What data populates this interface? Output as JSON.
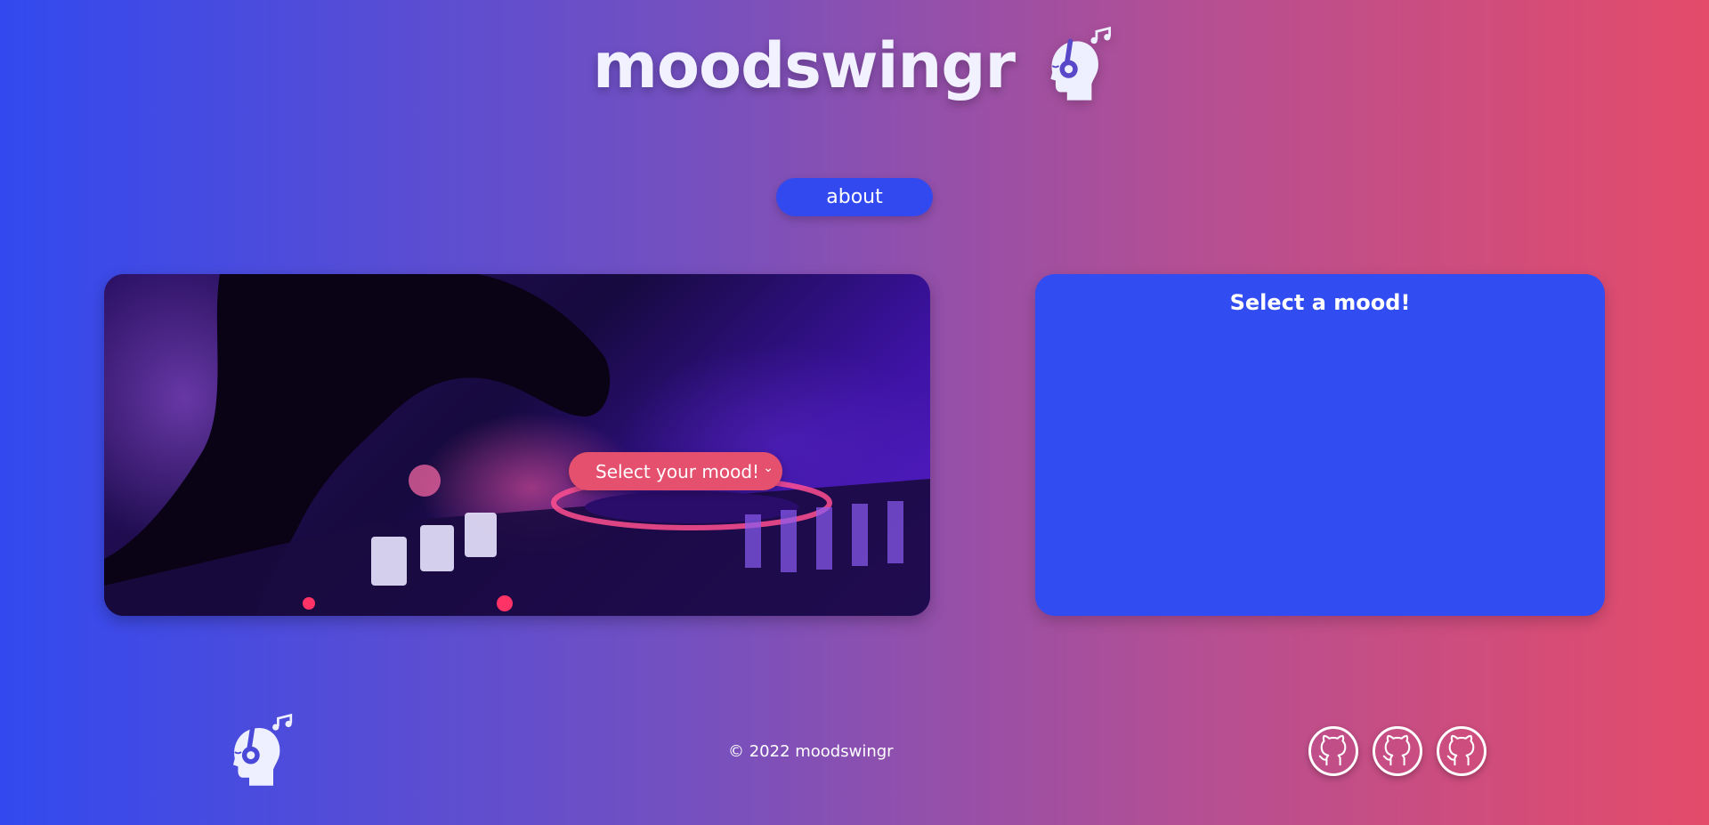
{
  "header": {
    "brand": "moodswingr",
    "logo_icon": "head-headphones-music-icon"
  },
  "nav": {
    "about_label": "about"
  },
  "hero": {
    "mood_select_value": "Select your mood!",
    "image_description_icon": "dj-mixer-image"
  },
  "mood_panel": {
    "title": "Select a mood!"
  },
  "footer": {
    "copyright": "© 2022 moodswingr",
    "logo_icon": "head-headphones-music-icon",
    "social_icons": [
      "github-icon",
      "github-icon",
      "github-icon"
    ]
  },
  "colors": {
    "primary_blue": "#3249ef",
    "accent_pink": "#e4506e",
    "gradient_start": "#3249ef",
    "gradient_end": "#e44b6a"
  }
}
